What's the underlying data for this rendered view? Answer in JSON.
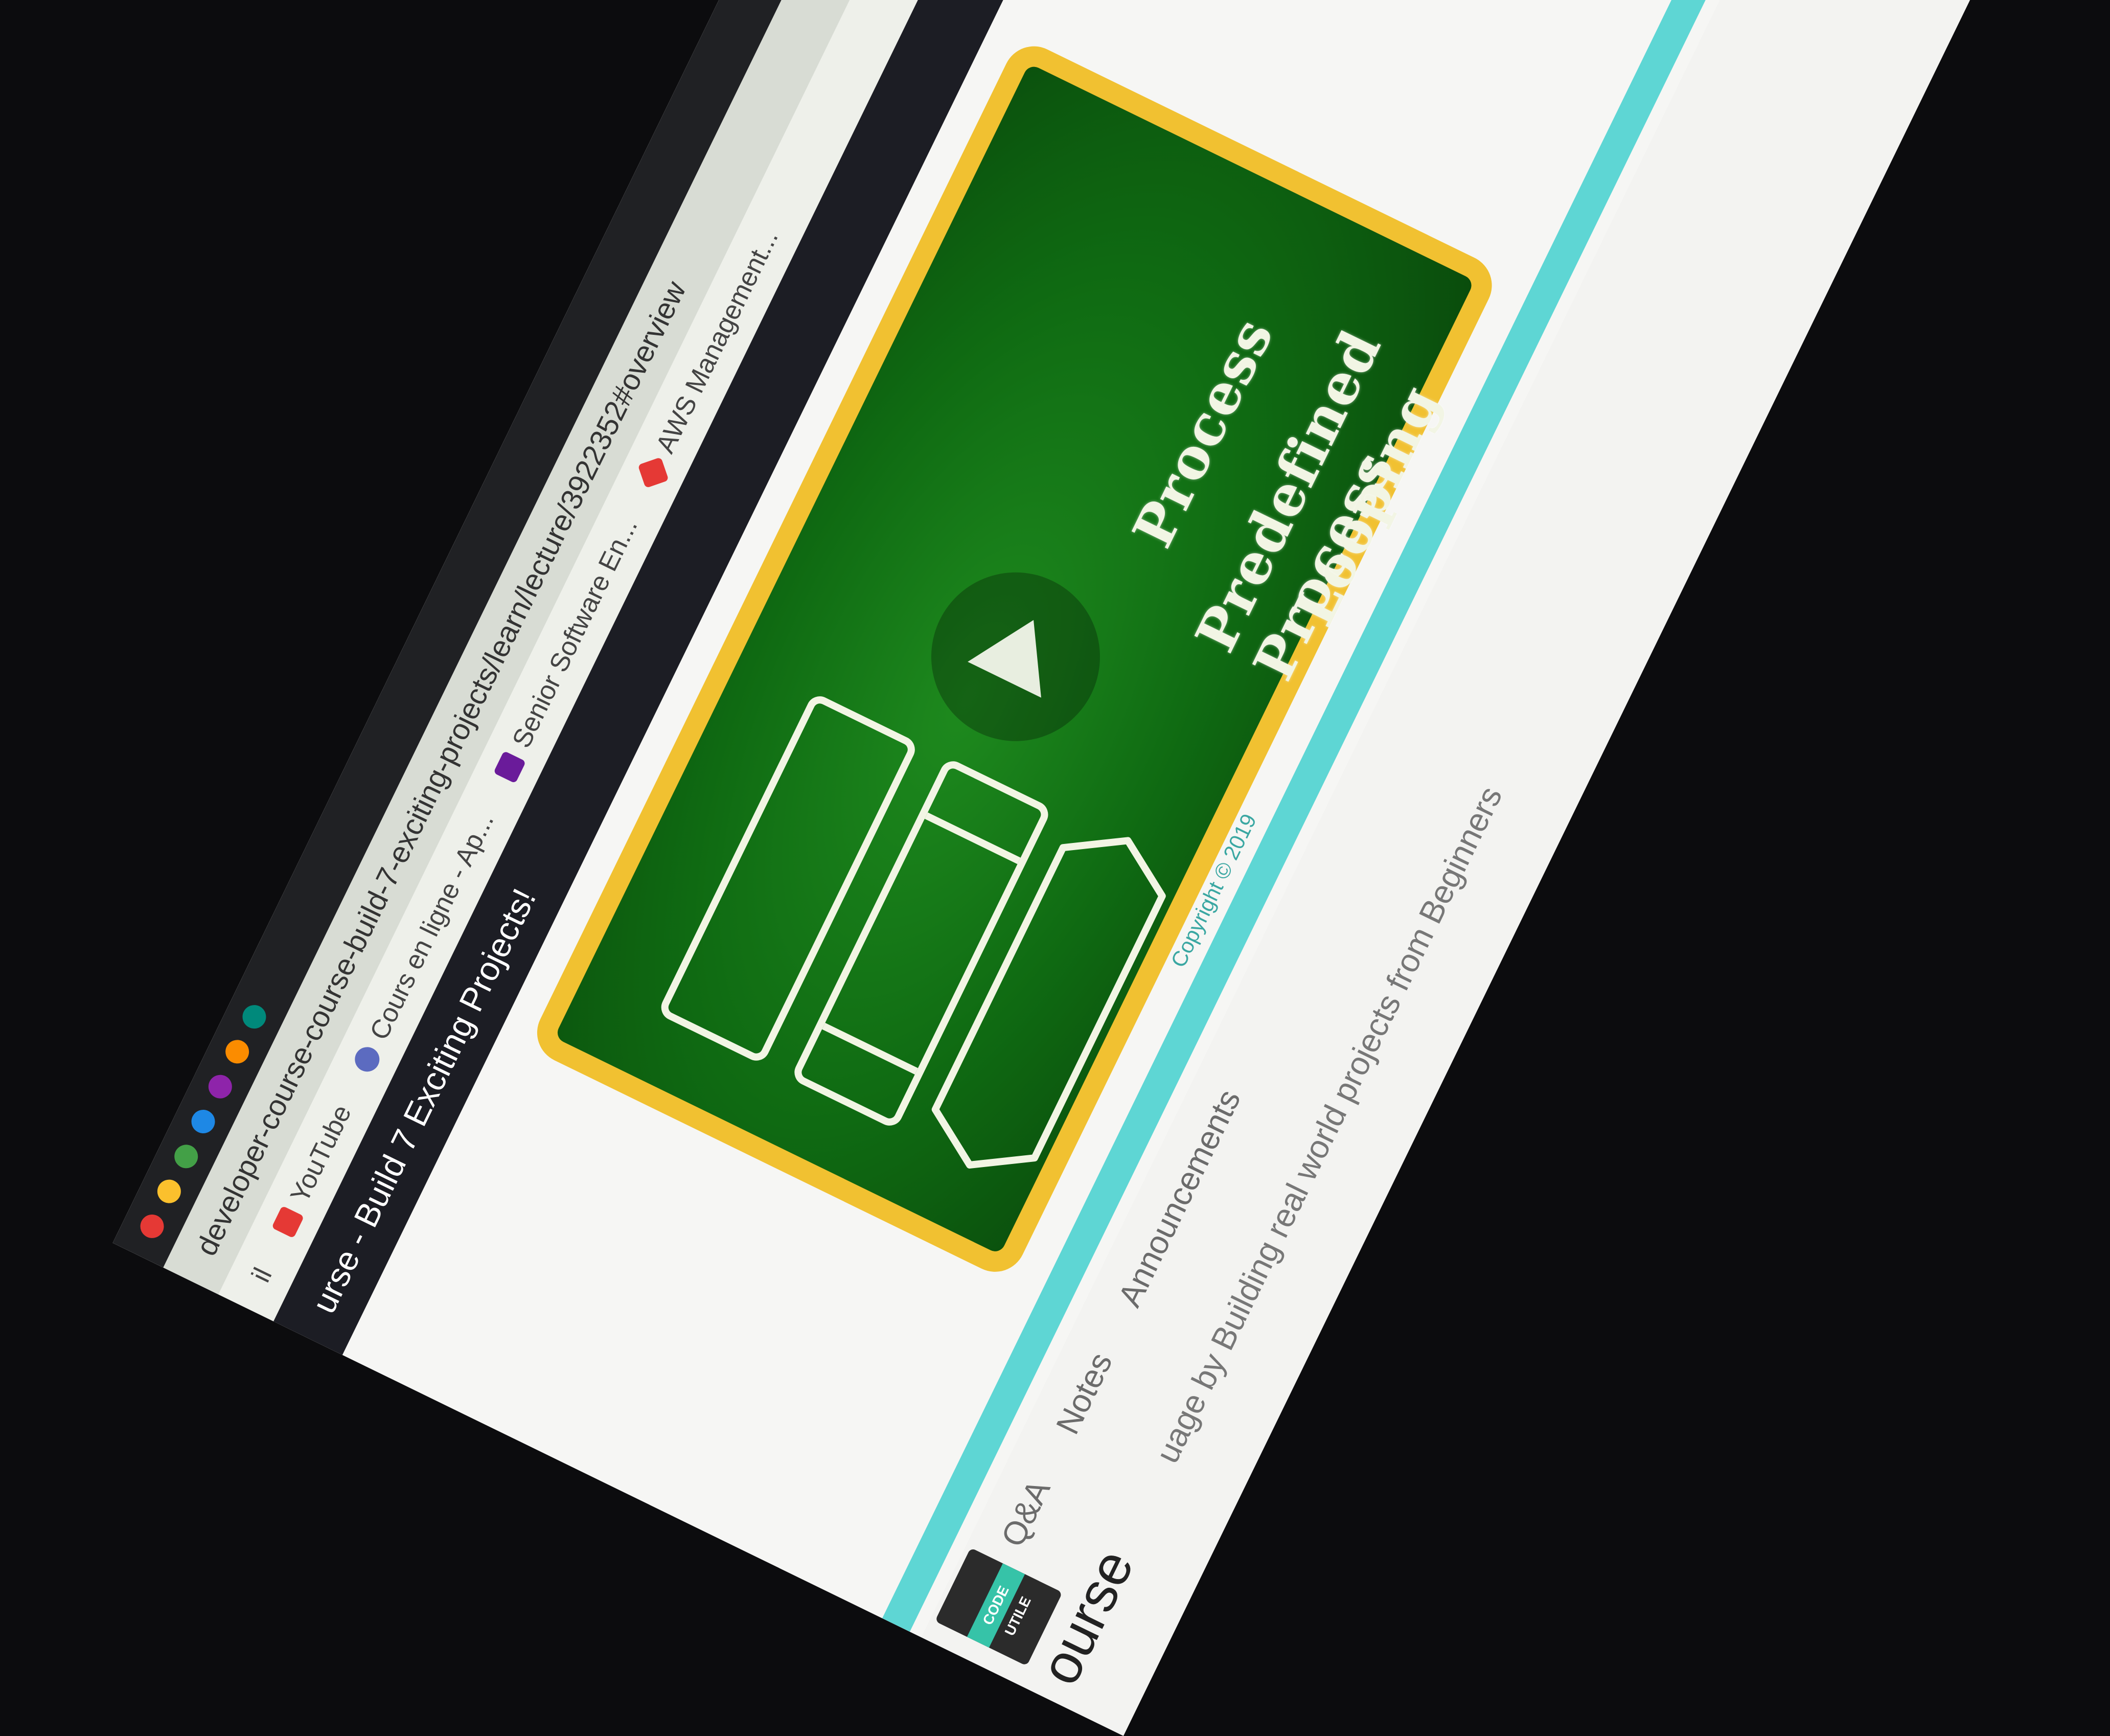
{
  "browser": {
    "address_bar": "developer-course-course-build-7-exciting-projects/learn/lecture/3922352#overview",
    "bookmarks": [
      {
        "label": "YouTube",
        "icon": "youtube-icon",
        "color": "#e53935"
      },
      {
        "label": "Cours en ligne - Ap...",
        "icon": "udemy-icon",
        "color": "#5c6bc0"
      },
      {
        "label": "Senior Software En...",
        "icon": "slack-icon",
        "color": "#6a1b9a"
      },
      {
        "label": "AWS Management...",
        "icon": "aws-icon",
        "color": "#e53935"
      }
    ],
    "partial_left_text": "il"
  },
  "course": {
    "title": "urse - Build 7 Exciting Projects!"
  },
  "video": {
    "labels": {
      "process": "Process",
      "predefined_process": "Predefined Process",
      "looping": "Looping"
    },
    "copyright": "Copyright © 2019",
    "colors": {
      "frame": "#f1c131",
      "board": "#137a16",
      "progress": "#5ed6d4"
    }
  },
  "tabs": [
    {
      "label": "Q&A"
    },
    {
      "label": "Notes"
    },
    {
      "label": "Announcements"
    }
  ],
  "badge": {
    "text": "CODE UTILE"
  },
  "heading": "ourse",
  "description": "uage by Building real world projects from Beginners"
}
